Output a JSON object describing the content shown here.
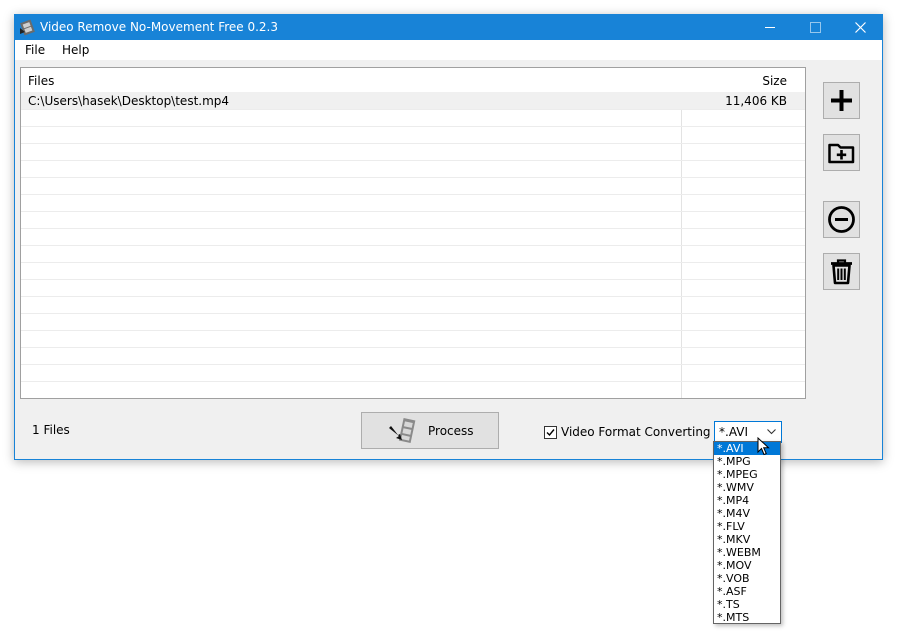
{
  "window": {
    "title": "Video Remove No-Movement Free 0.2.3",
    "accent_color": "#1883d7"
  },
  "menu": {
    "items": [
      "File",
      "Help"
    ]
  },
  "file_list": {
    "columns": {
      "files": "Files",
      "size": "Size"
    },
    "rows": [
      {
        "path": "C:\\Users\\hasek\\Desktop\\test.mp4",
        "size": "11,406 KB"
      }
    ]
  },
  "side_buttons": [
    {
      "icon": "plus-icon"
    },
    {
      "icon": "add-folder-icon"
    },
    {
      "icon": "minus-circle-icon"
    },
    {
      "icon": "trash-icon"
    }
  ],
  "status": {
    "file_count": "1 Files"
  },
  "process_button": {
    "label": "Process",
    "icon": "film-arrow-icon"
  },
  "format_converting": {
    "label": "Video Format Converting",
    "checked": true,
    "selected": "*.AVI",
    "options": [
      "*.AVI",
      "*.MPG",
      "*.MPEG",
      "*.WMV",
      "*.MP4",
      "*.M4V",
      "*.FLV",
      "*.MKV",
      "*.WEBM",
      "*.MOV",
      "*.VOB",
      "*.ASF",
      "*.TS",
      "*.MTS"
    ]
  }
}
